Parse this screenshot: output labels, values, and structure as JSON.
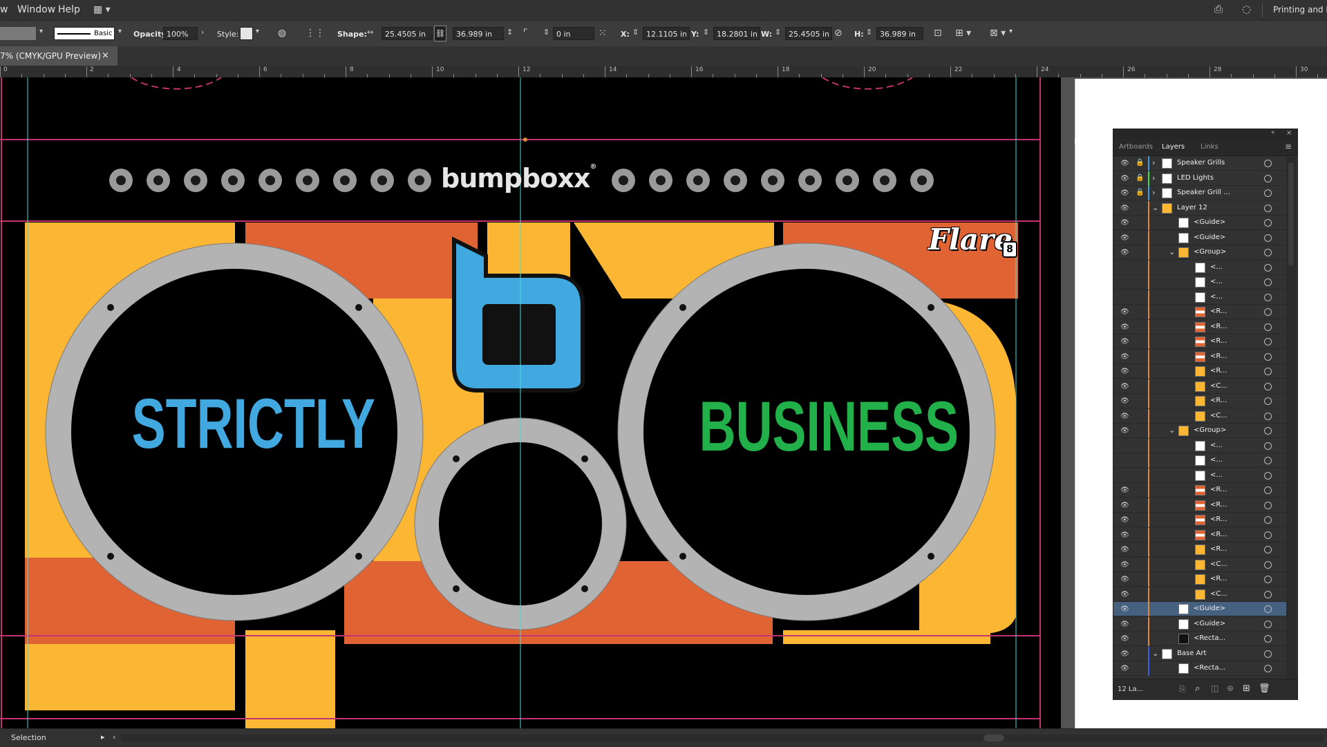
{
  "menu": {
    "items": [
      "w",
      "Window",
      "Help"
    ],
    "workspace_label": "Printing and P"
  },
  "control_bar": {
    "stroke_label": "Basic",
    "opacity_label": "Opacity:",
    "opacity_value": "100%",
    "style_label": "Style:",
    "shape_label": "Shape:",
    "shape_width": "25.4505 in",
    "shape_height": "36.989 in",
    "corner_value": "0 in",
    "x_label": "X:",
    "x_value": "12.1105 in",
    "y_label": "Y:",
    "y_value": "18.2801 in",
    "w_label": "W:",
    "w_value": "25.4505 in",
    "h_label": "H:",
    "h_value": "36.989 in"
  },
  "document_tab": {
    "title": "7% (CMYK/GPU Preview)",
    "close_glyph": "×"
  },
  "ruler": {
    "labels": [
      "0",
      "2",
      "4",
      "6",
      "8",
      "10",
      "12",
      "14",
      "16",
      "18",
      "20",
      "22",
      "24",
      "26",
      "28",
      "30"
    ]
  },
  "artwork": {
    "brand_wordmark": "bumpboxx",
    "brand_registered": "®",
    "flare_logo": "Flare",
    "flare_badge": "8",
    "left_text": "STRICTLY",
    "right_text": "BUSINESS",
    "colors": {
      "yellow": "#fbb633",
      "orange": "#e06333",
      "blue": "#42a9e0",
      "green": "#22b04b",
      "grille": "#b3b3b3",
      "guide_magenta": "#c2336f",
      "guide_cyan": "#4ad9d9"
    }
  },
  "layers_panel": {
    "tabs": [
      "Artboards",
      "Layers",
      "Links"
    ],
    "footer_label": "12 La...",
    "rows": [
      {
        "name": "Speaker Grills",
        "indent": 0,
        "thumb": "white",
        "color": "#3ca0e0",
        "expand": "›",
        "lock": true,
        "eye": true
      },
      {
        "name": "LED Lights",
        "indent": 0,
        "thumb": "white",
        "color": "#3fe04a",
        "expand": "›",
        "lock": true,
        "eye": true
      },
      {
        "name": "Speaker Grill ...",
        "indent": 0,
        "thumb": "white",
        "color": "#3ca0e0",
        "expand": "›",
        "lock": true,
        "eye": true
      },
      {
        "name": "Layer 12",
        "indent": 0,
        "thumb": "art",
        "color": "#e0893c",
        "expand": "⌄",
        "lock": false,
        "eye": true
      },
      {
        "name": "<Guide>",
        "indent": 1,
        "thumb": "white",
        "color": "#e0893c",
        "expand": "",
        "lock": false,
        "eye": true
      },
      {
        "name": "<Guide>",
        "indent": 1,
        "thumb": "white",
        "color": "#e0893c",
        "expand": "",
        "lock": false,
        "eye": true
      },
      {
        "name": "<Group>",
        "indent": 1,
        "thumb": "art",
        "color": "#e0893c",
        "expand": "⌄",
        "lock": false,
        "eye": true
      },
      {
        "name": "<...",
        "indent": 2,
        "thumb": "white",
        "color": "#e0893c",
        "expand": "",
        "lock": false,
        "eye": false
      },
      {
        "name": "<...",
        "indent": 2,
        "thumb": "white",
        "color": "#e0893c",
        "expand": "",
        "lock": false,
        "eye": false
      },
      {
        "name": "<...",
        "indent": 2,
        "thumb": "white",
        "color": "#e0893c",
        "expand": "",
        "lock": false,
        "eye": false
      },
      {
        "name": "<R...",
        "indent": 2,
        "thumb": "stripe",
        "color": "#e0893c",
        "expand": "",
        "lock": false,
        "eye": true
      },
      {
        "name": "<R...",
        "indent": 2,
        "thumb": "stripe",
        "color": "#e0893c",
        "expand": "",
        "lock": false,
        "eye": true
      },
      {
        "name": "<R...",
        "indent": 2,
        "thumb": "stripe",
        "color": "#e0893c",
        "expand": "",
        "lock": false,
        "eye": true
      },
      {
        "name": "<R...",
        "indent": 2,
        "thumb": "stripe",
        "color": "#e0893c",
        "expand": "",
        "lock": false,
        "eye": true
      },
      {
        "name": "<R...",
        "indent": 2,
        "thumb": "yellow",
        "color": "#e0893c",
        "expand": "",
        "lock": false,
        "eye": true
      },
      {
        "name": "<C...",
        "indent": 2,
        "thumb": "yellow",
        "color": "#e0893c",
        "expand": "",
        "lock": false,
        "eye": true
      },
      {
        "name": "<R...",
        "indent": 2,
        "thumb": "yellow",
        "color": "#e0893c",
        "expand": "",
        "lock": false,
        "eye": true
      },
      {
        "name": "<C...",
        "indent": 2,
        "thumb": "yellow",
        "color": "#e0893c",
        "expand": "",
        "lock": false,
        "eye": true
      },
      {
        "name": "<Group>",
        "indent": 1,
        "thumb": "art",
        "color": "#e0893c",
        "expand": "⌄",
        "lock": false,
        "eye": true
      },
      {
        "name": "<...",
        "indent": 2,
        "thumb": "white",
        "color": "#e0893c",
        "expand": "",
        "lock": false,
        "eye": false
      },
      {
        "name": "<...",
        "indent": 2,
        "thumb": "white",
        "color": "#e0893c",
        "expand": "",
        "lock": false,
        "eye": false
      },
      {
        "name": "<...",
        "indent": 2,
        "thumb": "white",
        "color": "#e0893c",
        "expand": "",
        "lock": false,
        "eye": false
      },
      {
        "name": "<R...",
        "indent": 2,
        "thumb": "stripe",
        "color": "#e0893c",
        "expand": "",
        "lock": false,
        "eye": true
      },
      {
        "name": "<R...",
        "indent": 2,
        "thumb": "stripe",
        "color": "#e0893c",
        "expand": "",
        "lock": false,
        "eye": true
      },
      {
        "name": "<R...",
        "indent": 2,
        "thumb": "stripe",
        "color": "#e0893c",
        "expand": "",
        "lock": false,
        "eye": true
      },
      {
        "name": "<R...",
        "indent": 2,
        "thumb": "stripe",
        "color": "#e0893c",
        "expand": "",
        "lock": false,
        "eye": true
      },
      {
        "name": "<R...",
        "indent": 2,
        "thumb": "yellow",
        "color": "#e0893c",
        "expand": "",
        "lock": false,
        "eye": true
      },
      {
        "name": "<C...",
        "indent": 2,
        "thumb": "yellow",
        "color": "#e0893c",
        "expand": "",
        "lock": false,
        "eye": true
      },
      {
        "name": "<R...",
        "indent": 2,
        "thumb": "yellow",
        "color": "#e0893c",
        "expand": "",
        "lock": false,
        "eye": true
      },
      {
        "name": "<C...",
        "indent": 2,
        "thumb": "yellow",
        "color": "#e0893c",
        "expand": "",
        "lock": false,
        "eye": true
      },
      {
        "name": "<Guide>",
        "indent": 1,
        "thumb": "white",
        "color": "#e0893c",
        "expand": "",
        "lock": false,
        "eye": true,
        "selected": true
      },
      {
        "name": "<Guide>",
        "indent": 1,
        "thumb": "white",
        "color": "#e0893c",
        "expand": "",
        "lock": false,
        "eye": true
      },
      {
        "name": "<Recta...",
        "indent": 1,
        "thumb": "black",
        "color": "#e0893c",
        "expand": "",
        "lock": false,
        "eye": true
      },
      {
        "name": "Base Art",
        "indent": 0,
        "thumb": "white",
        "color": "#3c5fe0",
        "expand": "⌄",
        "lock": false,
        "eye": true
      },
      {
        "name": "<Recta...",
        "indent": 1,
        "thumb": "white",
        "color": "#3c5fe0",
        "expand": "",
        "lock": false,
        "eye": true
      }
    ]
  },
  "status": {
    "tool": "Selection"
  }
}
